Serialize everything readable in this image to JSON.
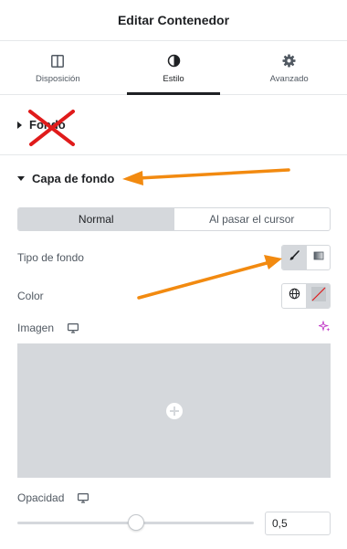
{
  "header": {
    "title": "Editar Contenedor"
  },
  "tabs": [
    {
      "label": "Disposición",
      "icon": "layout-columns-icon"
    },
    {
      "label": "Estilo",
      "icon": "contrast-icon",
      "active": true
    },
    {
      "label": "Avanzado",
      "icon": "gear-icon"
    }
  ],
  "sections": {
    "fondo": {
      "label": "Fondo",
      "state": "collapsed"
    },
    "capa": {
      "label": "Capa de fondo",
      "state": "expanded"
    }
  },
  "state_toggle": {
    "normal": "Normal",
    "hover": "Al pasar el cursor",
    "active": "Normal"
  },
  "fields": {
    "tipo_fondo": {
      "label": "Tipo de fondo",
      "options": [
        "classic-brush-icon",
        "gradient-icon"
      ],
      "selected": "classic-brush-icon"
    },
    "color": {
      "label": "Color",
      "buttons": [
        "globe-icon",
        "no-color-icon"
      ]
    },
    "imagen": {
      "label": "Imagen",
      "device_icon": "desktop-icon",
      "ai_icon": "sparkle-ai-icon"
    },
    "opacidad": {
      "label": "Opacidad",
      "device_icon": "desktop-icon",
      "value": "0,5",
      "fraction": 0.5
    }
  },
  "annotations": {
    "cross_mark": "red-x-icon",
    "arrows": [
      "orange-arrow-icon",
      "orange-arrow-icon"
    ],
    "colors": {
      "cross": "#e01b1b",
      "arrow": "#f28a10",
      "accent_ai": "#c036c7"
    }
  }
}
